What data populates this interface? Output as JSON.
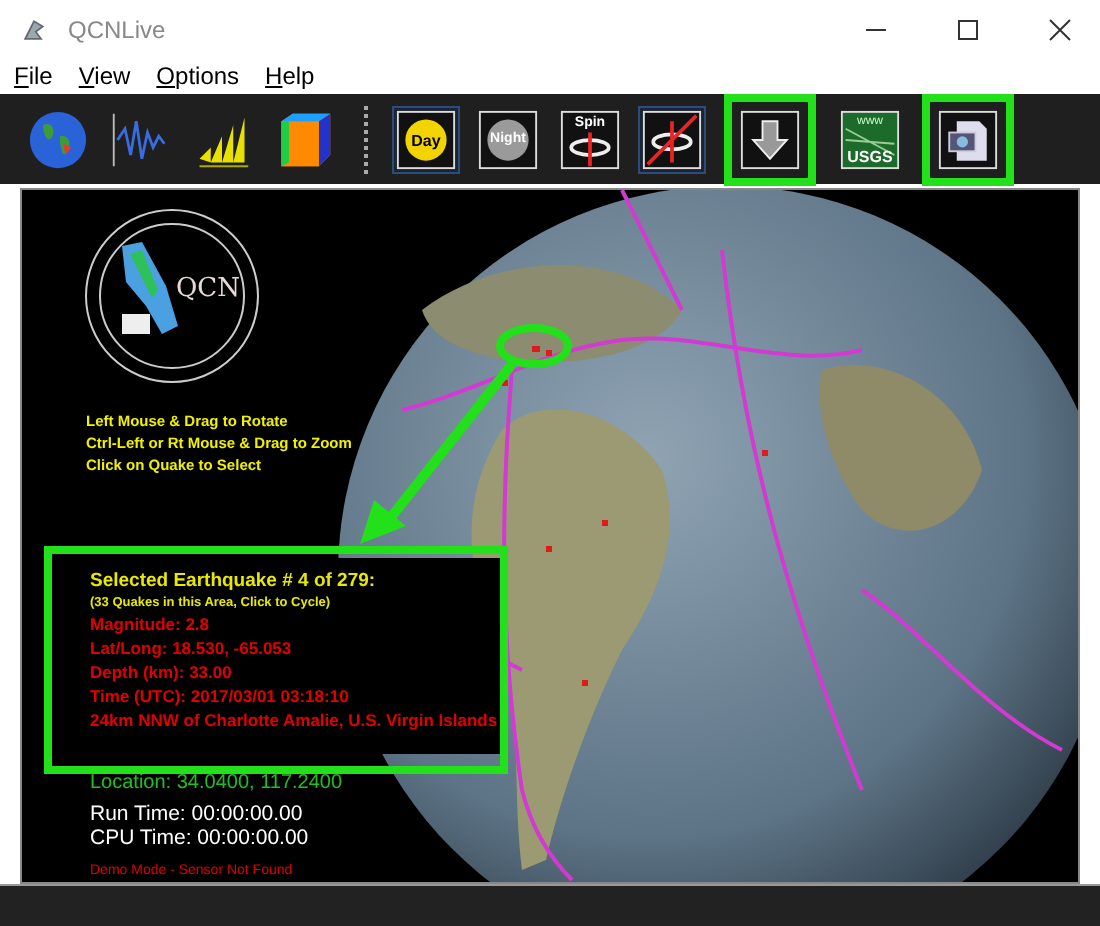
{
  "window": {
    "title": "QCNLive"
  },
  "menu": [
    {
      "label": "File"
    },
    {
      "label": "View"
    },
    {
      "label": "Options"
    },
    {
      "label": "Help"
    }
  ],
  "toolbar": [
    {
      "kind": "globe",
      "pressed": false,
      "highlighted": false
    },
    {
      "kind": "wave",
      "pressed": false,
      "highlighted": false
    },
    {
      "kind": "bars",
      "pressed": false,
      "highlighted": false
    },
    {
      "kind": "cube",
      "pressed": false,
      "highlighted": false
    },
    {
      "kind": "separator"
    },
    {
      "kind": "day",
      "label": "Day",
      "pressed": true,
      "highlighted": false
    },
    {
      "kind": "night",
      "label": "Night",
      "pressed": false,
      "highlighted": false
    },
    {
      "kind": "spin",
      "label": "Spin",
      "pressed": false,
      "highlighted": false
    },
    {
      "kind": "nospin",
      "pressed": true,
      "highlighted": false
    },
    {
      "kind": "download",
      "pressed": false,
      "highlighted": true
    },
    {
      "kind": "usgs",
      "label": "USGS",
      "sublabel": "www",
      "pressed": false,
      "highlighted": false
    },
    {
      "kind": "screenshot",
      "pressed": false,
      "highlighted": true
    }
  ],
  "logo": {
    "text": "QCN"
  },
  "help_lines": [
    "Left Mouse & Drag to Rotate",
    "Ctrl-Left or Rt Mouse & Drag to Zoom",
    "Click on Quake to Select"
  ],
  "quake_info": {
    "title": "Selected Earthquake # 4 of 279:",
    "subtitle": "(33 Quakes in this Area, Click to Cycle)",
    "lines": [
      "Magnitude:  2.8",
      "Lat/Long:   18.530,  -65.053",
      "Depth (km):  33.00",
      "Time (UTC): 2017/03/01 03:18:10",
      "24km NNW of Charlotte Amalie, U.S. Virgin Islands"
    ],
    "highlighted": true
  },
  "location": "Location: 34.0400, 117.2400",
  "run_time": "Run Time: 00:00:00.00",
  "cpu_time": "CPU Time: 00:00:00.00",
  "status": "Demo Mode - Sensor Not Found"
}
